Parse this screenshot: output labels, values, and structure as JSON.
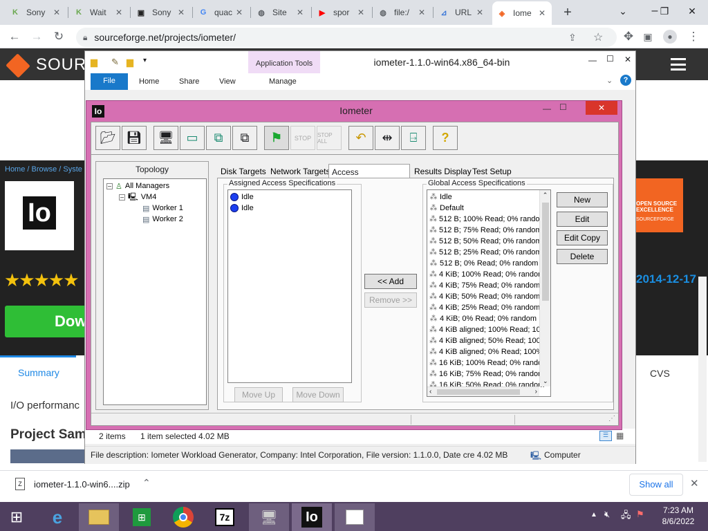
{
  "browser": {
    "tabs": [
      {
        "title": "Sony",
        "favicon": "K",
        "color": "#6aa84f"
      },
      {
        "title": "Wait",
        "favicon": "K",
        "color": "#6aa84f"
      },
      {
        "title": "Sony",
        "favicon": "▣",
        "color": "#222222"
      },
      {
        "title": "quac",
        "favicon": "G",
        "color": "#4285f4"
      },
      {
        "title": "Site",
        "favicon": "◍",
        "color": "#5f6368"
      },
      {
        "title": "spor",
        "favicon": "▶",
        "color": "#ff0000"
      },
      {
        "title": "file:/",
        "favicon": "◍",
        "color": "#5f6368"
      },
      {
        "title": "URL",
        "favicon": "⊿",
        "color": "#3c78d8"
      },
      {
        "title": "Iome",
        "favicon": "◈",
        "color": "#f26522"
      }
    ],
    "new_tab": "+",
    "url": "sourceforge.net/projects/iometer/"
  },
  "site": {
    "logo_text": "SOURC",
    "breadcrumb": "Home / Browse / Syste",
    "project_logo": "Io",
    "download_label": "Dow",
    "badge_line1": "OPEN SOURCE",
    "badge_line2": "EXCELLENCE",
    "badge_brand": "SOURCEFORGE",
    "date": "2014-12-17",
    "tab_summary": "Summary",
    "tab_cvs": "CVS",
    "tagline": "I/O performanc",
    "samples": "Project Sam"
  },
  "explorer": {
    "title": "iometer-1.1.0-win64.x86_64-bin",
    "context_tab": "Application Tools",
    "ribbon": [
      "File",
      "Home",
      "Share",
      "View",
      "Manage"
    ],
    "status_items": "2 items",
    "status_selected": "1 item selected  4.02 MB",
    "description": "File description: Iometer Workload Generator, Company: Intel Corporation, File version: 1.1.0.0, Date cre 4.02 MB",
    "location": "Computer"
  },
  "iometer": {
    "title": "Iometer",
    "topology_label": "Topology",
    "tree": {
      "root": "All Managers",
      "manager": "VM4",
      "workers": [
        "Worker 1",
        "Worker 2"
      ]
    },
    "tabs": [
      "Disk Targets",
      "Network Targets",
      "Access Specifications",
      "Results Display",
      "Test Setup"
    ],
    "assigned_label": "Assigned Access Specifications",
    "assigned": [
      "Idle",
      "Idle"
    ],
    "global_label": "Global Access Specifications",
    "global": [
      "Idle",
      "Default",
      "512 B; 100% Read; 0% randor",
      "512 B; 75% Read; 0% random",
      "512 B; 50% Read; 0% random",
      "512 B; 25% Read; 0% random",
      "512 B; 0% Read; 0% random",
      "4 KiB; 100% Read; 0% random",
      "4 KiB; 75% Read; 0% random",
      "4 KiB; 50% Read; 0% random",
      "4 KiB; 25% Read; 0% random",
      "4 KiB; 0% Read; 0% random",
      "4 KiB aligned; 100% Read; 10",
      "4 KiB aligned; 50% Read; 100",
      "4 KiB aligned; 0% Read; 100%",
      "16 KiB; 100% Read; 0% rando",
      "16 KiB; 75% Read; 0% random",
      "16 KiB; 50% Read; 0% random"
    ],
    "buttons": {
      "add": "<< Add",
      "remove": "Remove >>",
      "move_up": "Move Up",
      "move_down": "Move Down",
      "new": "New",
      "edit": "Edit",
      "edit_copy": "Edit Copy",
      "delete": "Delete"
    }
  },
  "download": {
    "file": "iometer-1.1.0-win6....zip",
    "show_all": "Show all"
  },
  "taskbar": {
    "time": "7:23 AM",
    "date": "8/6/2022"
  }
}
